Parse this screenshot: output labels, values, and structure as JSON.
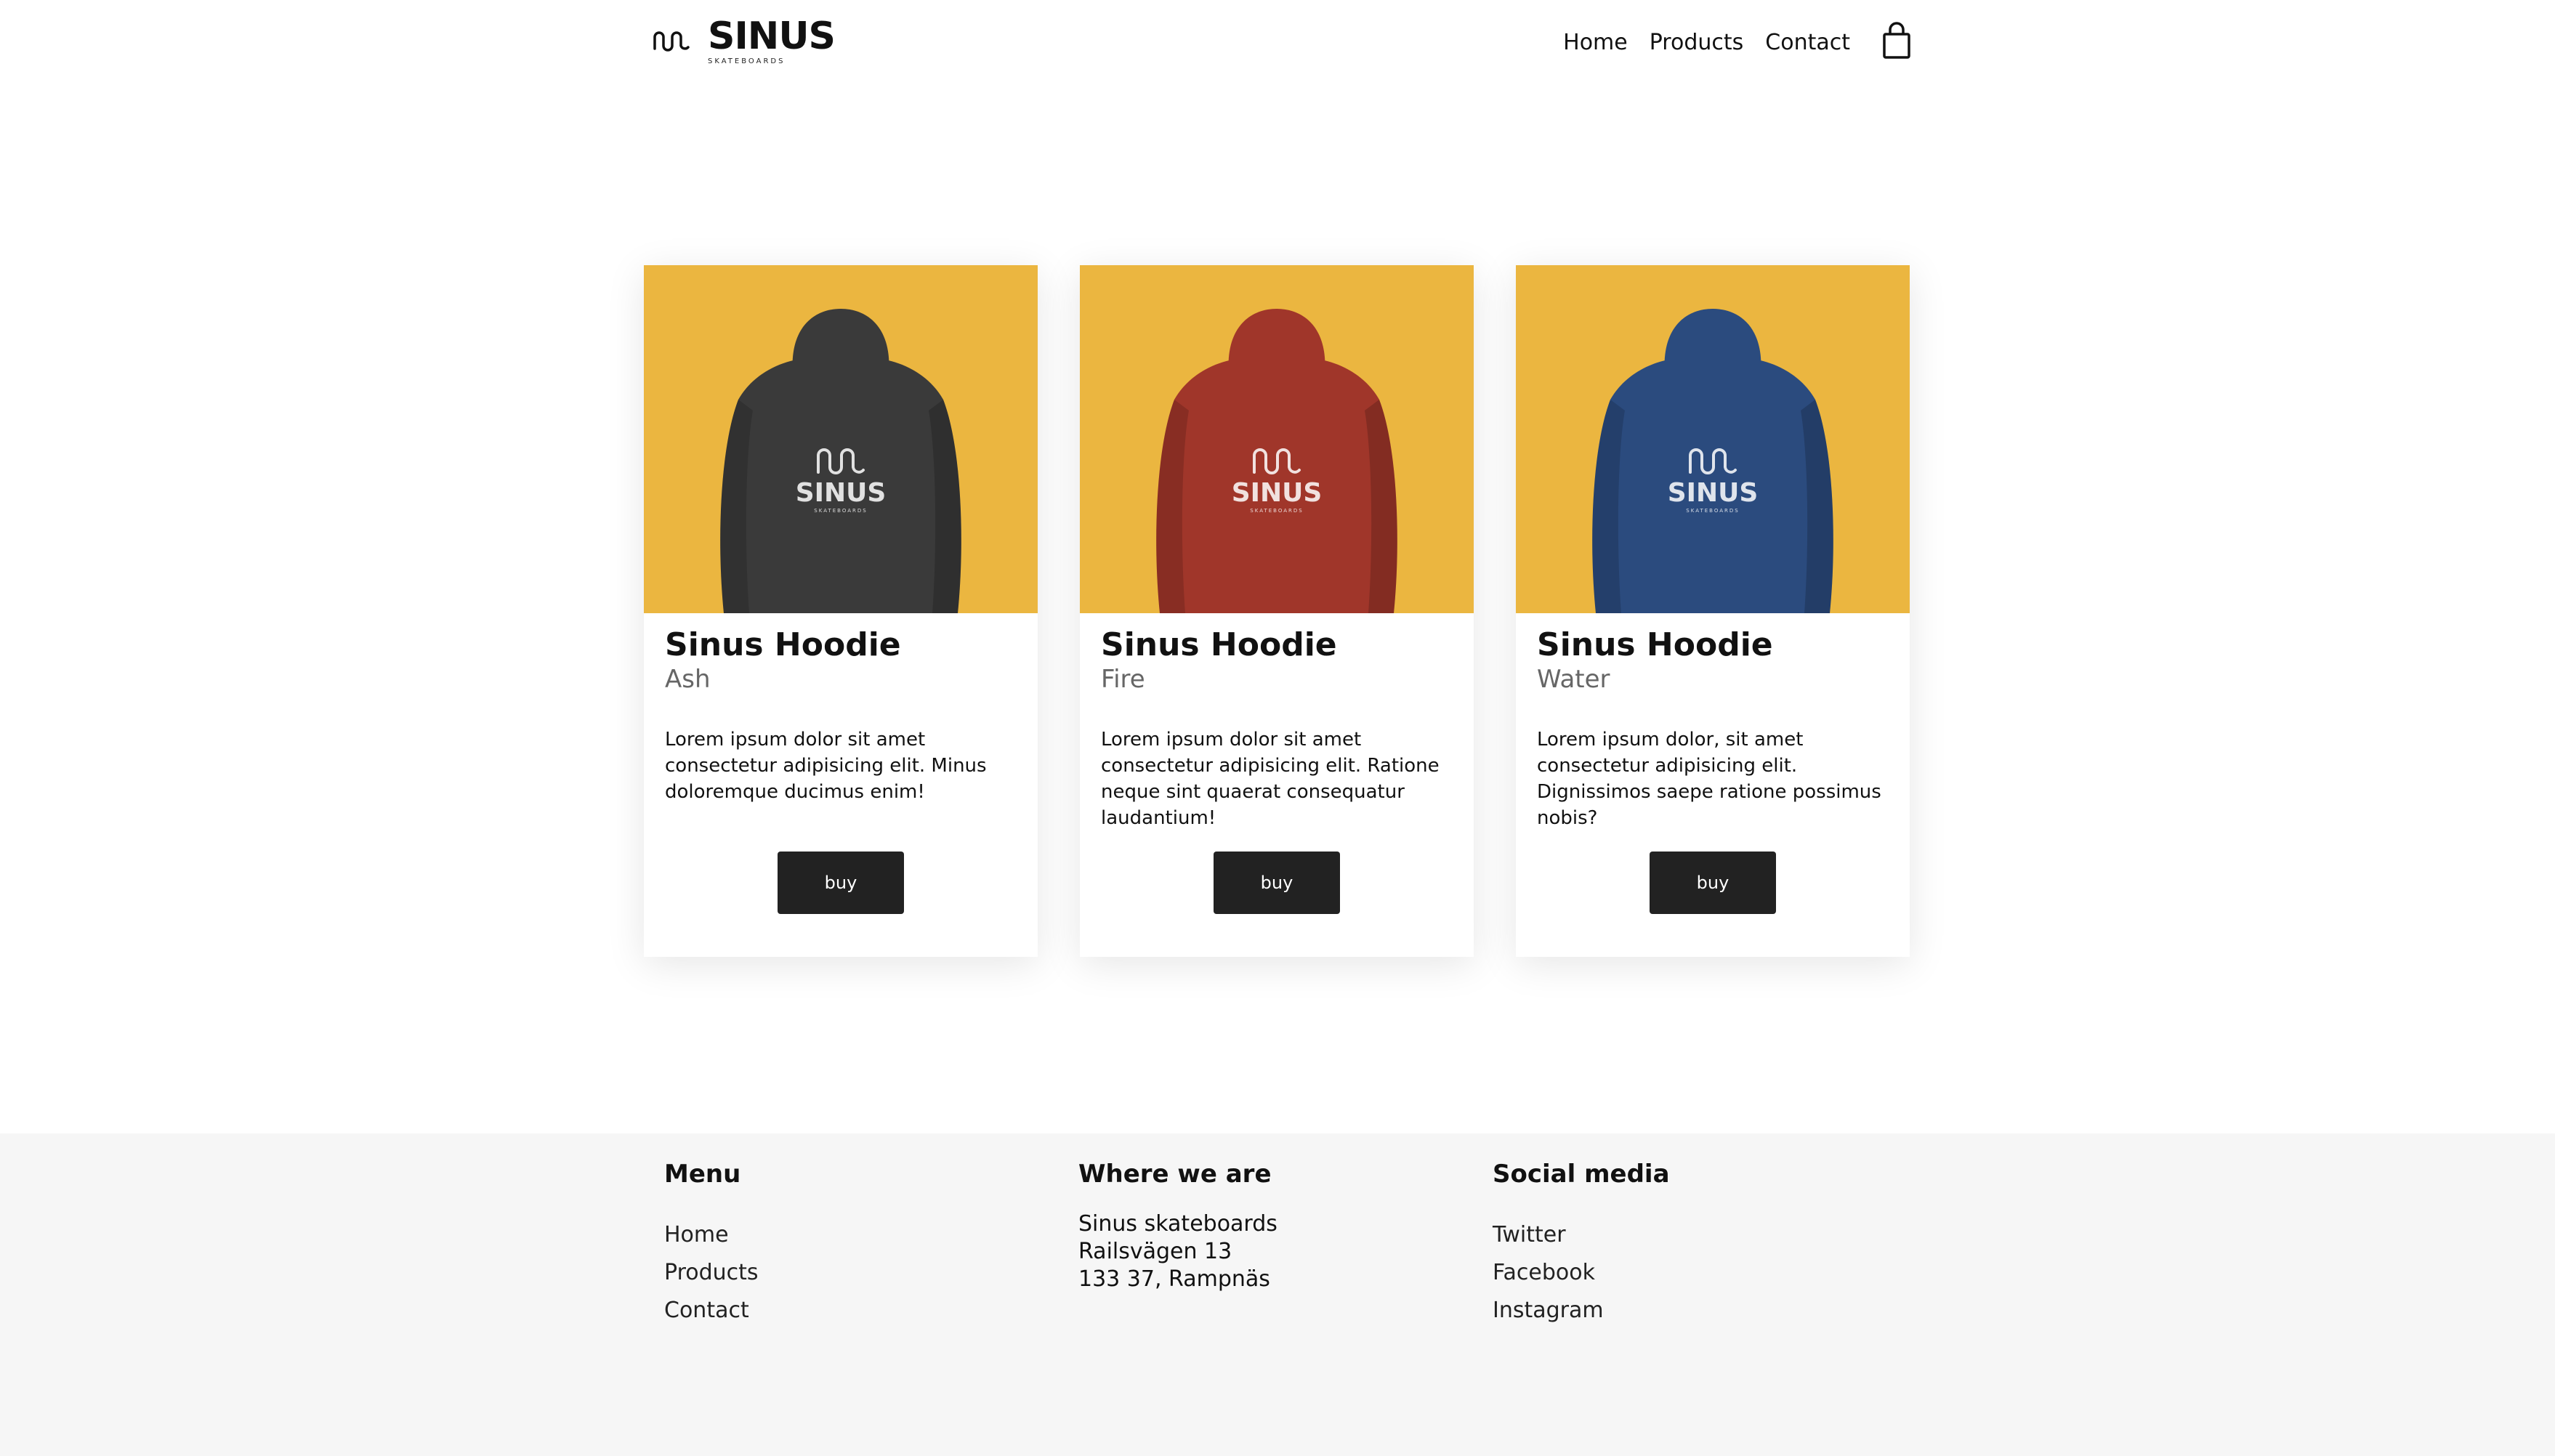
{
  "brand": {
    "name": "SINUS",
    "tagline": "SKATEBOARDS"
  },
  "nav": {
    "items": [
      "Home",
      "Products",
      "Contact"
    ],
    "cart_icon": "shopping-bag-icon"
  },
  "colors": {
    "product_bg": "#ebb640",
    "button_bg": "#222222",
    "footer_bg": "#f6f6f6",
    "hoodie_ash": "#3a3a3a",
    "hoodie_fire": "#a0362a",
    "hoodie_water": "#2b4b7e"
  },
  "products": [
    {
      "title": "Sinus Hoodie",
      "variant": "Ash",
      "description": "Lorem ipsum dolor sit amet consectetur adipisicing elit. Minus doloremque ducimus enim!",
      "button": "buy",
      "print": "SINUS",
      "print_sub": "SKATEBOARDS"
    },
    {
      "title": "Sinus Hoodie",
      "variant": "Fire",
      "description": "Lorem ipsum dolor sit amet consectetur adipisicing elit. Ratione neque sint quaerat consequatur laudantium!",
      "button": "buy",
      "print": "SINUS",
      "print_sub": "SKATEBOARDS"
    },
    {
      "title": "Sinus Hoodie",
      "variant": "Water",
      "description": "Lorem ipsum dolor, sit amet consectetur adipisicing elit. Dignissimos saepe ratione possimus nobis?",
      "button": "buy",
      "print": "SINUS",
      "print_sub": "SKATEBOARDS"
    }
  ],
  "footer": {
    "menu": {
      "heading": "Menu",
      "items": [
        "Home",
        "Products",
        "Contact"
      ]
    },
    "location": {
      "heading": "Where we are",
      "lines": [
        "Sinus skateboards",
        "Railsvägen 13",
        "133 37, Rampnäs"
      ]
    },
    "social": {
      "heading": "Social media",
      "items": [
        "Twitter",
        "Facebook",
        "Instagram"
      ]
    }
  }
}
